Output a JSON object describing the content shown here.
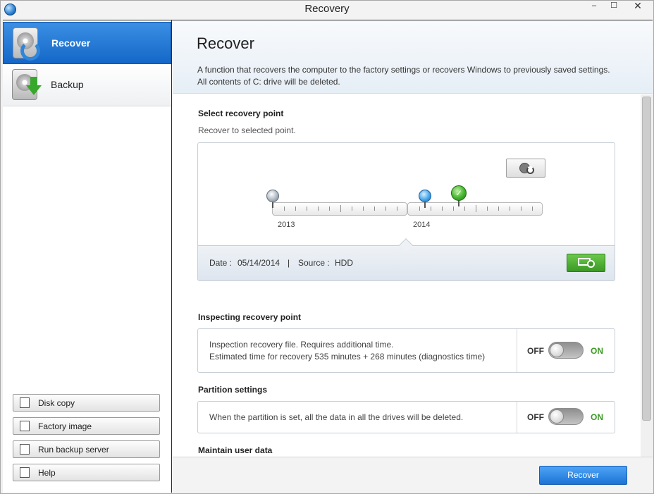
{
  "window": {
    "title": "Recovery",
    "minimize": "–",
    "maximize": "☐",
    "close": "✕"
  },
  "sidebar": {
    "nav": [
      {
        "label": "Recover",
        "icon": "recover-disk-icon",
        "active": true
      },
      {
        "label": "Backup",
        "icon": "backup-disk-icon",
        "active": false
      }
    ],
    "buttons": [
      {
        "label": "Disk copy",
        "icon": "disk-copy-icon"
      },
      {
        "label": "Factory image",
        "icon": "factory-image-icon"
      },
      {
        "label": "Run backup server",
        "icon": "backup-server-icon"
      },
      {
        "label": "Help",
        "icon": "help-icon"
      }
    ]
  },
  "main": {
    "title": "Recover",
    "description_line1": "A function that recovers the computer to the factory settings or recovers Windows to previously saved settings.",
    "description_line2": "All contents of C: drive will be deleted.",
    "recovery_point": {
      "title": "Select recovery point",
      "subtitle": "Recover to selected point.",
      "years": [
        "2013",
        "2014"
      ],
      "date_label": "Date :",
      "date_value": "05/14/2014",
      "separator": "|",
      "source_label": "Source :",
      "source_value": "HDD",
      "selected_check": "✓"
    },
    "inspecting": {
      "title": "Inspecting recovery point",
      "line1": "Inspection recovery file. Requires additional time.",
      "line2": "Estimated time for recovery 535 minutes + 268 minutes (diagnostics time)",
      "off_label": "OFF",
      "on_label": "ON",
      "state": "off"
    },
    "partition": {
      "title": "Partition settings",
      "text": "When the partition is set, all the data in all the drives will be deleted.",
      "off_label": "OFF",
      "on_label": "ON",
      "state": "off"
    },
    "maintain": {
      "title": "Maintain user data"
    },
    "primary_button": "Recover"
  },
  "colors": {
    "accent_blue": "#1467c8",
    "on_green": "#3b9a24",
    "border": "#c8ced6"
  }
}
